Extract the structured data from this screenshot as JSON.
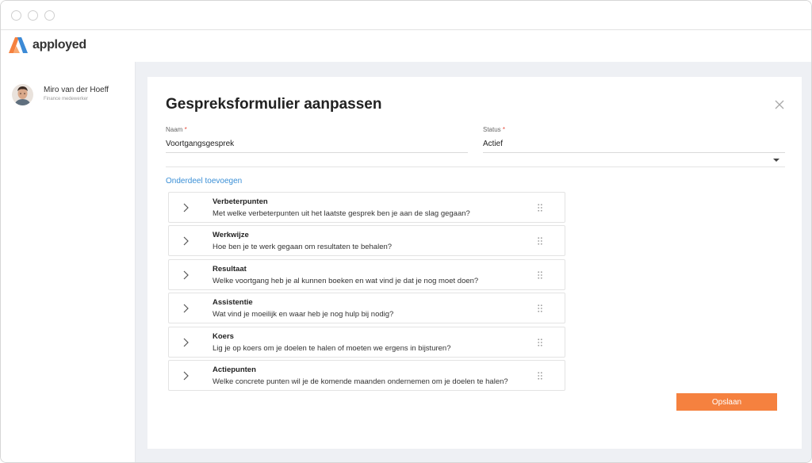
{
  "app": {
    "brand": "apployed",
    "colors": {
      "accent": "#f5813f",
      "link": "#3a8fd6",
      "logo_blue": "#3c8ad6",
      "logo_orange": "#f5813f"
    }
  },
  "user": {
    "name": "Miro van der Hoeff",
    "role": "Finance medewerker"
  },
  "form": {
    "title": "Gespreksformulier aanpassen",
    "name_field": {
      "label": "Naam",
      "required_mark": "*",
      "value": "Voortgangsgesprek"
    },
    "status_field": {
      "label": "Status",
      "required_mark": "*",
      "value": "Actief"
    },
    "add_section_link": "Onderdeel toevoegen",
    "sections": [
      {
        "title": "Verbeterpunten",
        "question": "Met welke verbeterpunten uit het laatste gesprek ben je aan de slag gegaan?"
      },
      {
        "title": "Werkwijze",
        "question": "Hoe ben je te werk gegaan om resultaten te behalen?"
      },
      {
        "title": "Resultaat",
        "question": "Welke voortgang heb je al kunnen boeken en wat vind je dat je nog moet doen?"
      },
      {
        "title": "Assistentie",
        "question": "Wat vind je moeilijk en waar heb je nog hulp bij nodig?"
      },
      {
        "title": "Koers",
        "question": "Lig je op koers om je doelen te halen of moeten we ergens in bijsturen?"
      },
      {
        "title": "Actiepunten",
        "question": "Welke concrete punten wil je de komende maanden ondernemen om je doelen te halen?"
      }
    ],
    "save_label": "Opslaan"
  },
  "icons": {
    "close": "close-icon",
    "expand": "chevron-right-icon",
    "drag": "drag-handle-icon",
    "dropdown": "caret-down-icon"
  }
}
